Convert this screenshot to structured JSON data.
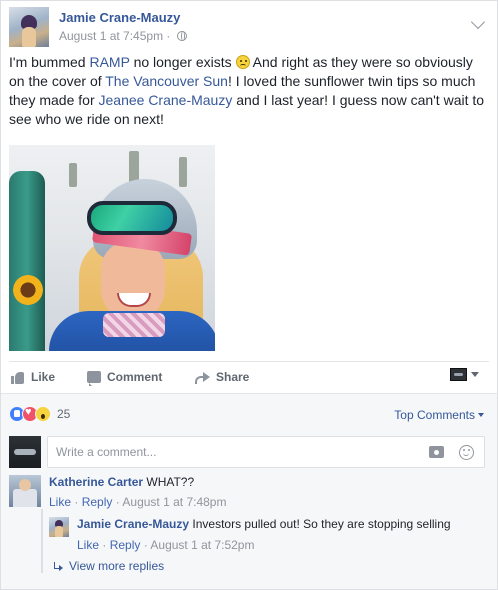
{
  "post": {
    "author": "Jamie Crane-Mauzy",
    "timestamp": "August 1 at 7:45pm",
    "separator": "·",
    "text_parts": {
      "t1": "I'm bummed ",
      "link_ramp": "RAMP",
      "t2": " no longer exists ",
      "t3": " And right as they were so obviously on the cover of ",
      "link_sun": "The Vancouver Sun",
      "t4": "! I loved the sunflower twin tips so much they made for ",
      "link_jeanee": "Jeanee Crane-Mauzy",
      "t5": " and I last year! I guess now can't wait to see who we ride on next!"
    },
    "photo_icon": "skier-portrait-photo"
  },
  "actions": {
    "like": "Like",
    "comment": "Comment",
    "share": "Share"
  },
  "reactions": {
    "types": [
      "like",
      "love",
      "wow"
    ],
    "count": "25",
    "sort_label": "Top Comments"
  },
  "composer": {
    "placeholder": "Write a comment..."
  },
  "comments": [
    {
      "author": "Katherine Carter",
      "text": "WHAT??",
      "like": "Like",
      "reply": "Reply",
      "dot": "·",
      "time": "August 1 at 7:48pm"
    },
    {
      "author": "Jamie Crane-Mauzy",
      "text": "Investors pulled out! So they are stopping selling",
      "like": "Like",
      "reply": "Reply",
      "dot": "·",
      "time": "August 1 at 7:52pm"
    }
  ],
  "view_more": "View more replies",
  "colors": {
    "link": "#365899",
    "meta": "#90949c",
    "like_blue": "#4080ff",
    "love_red": "#f25268",
    "wow_yellow": "#f7d33d"
  }
}
